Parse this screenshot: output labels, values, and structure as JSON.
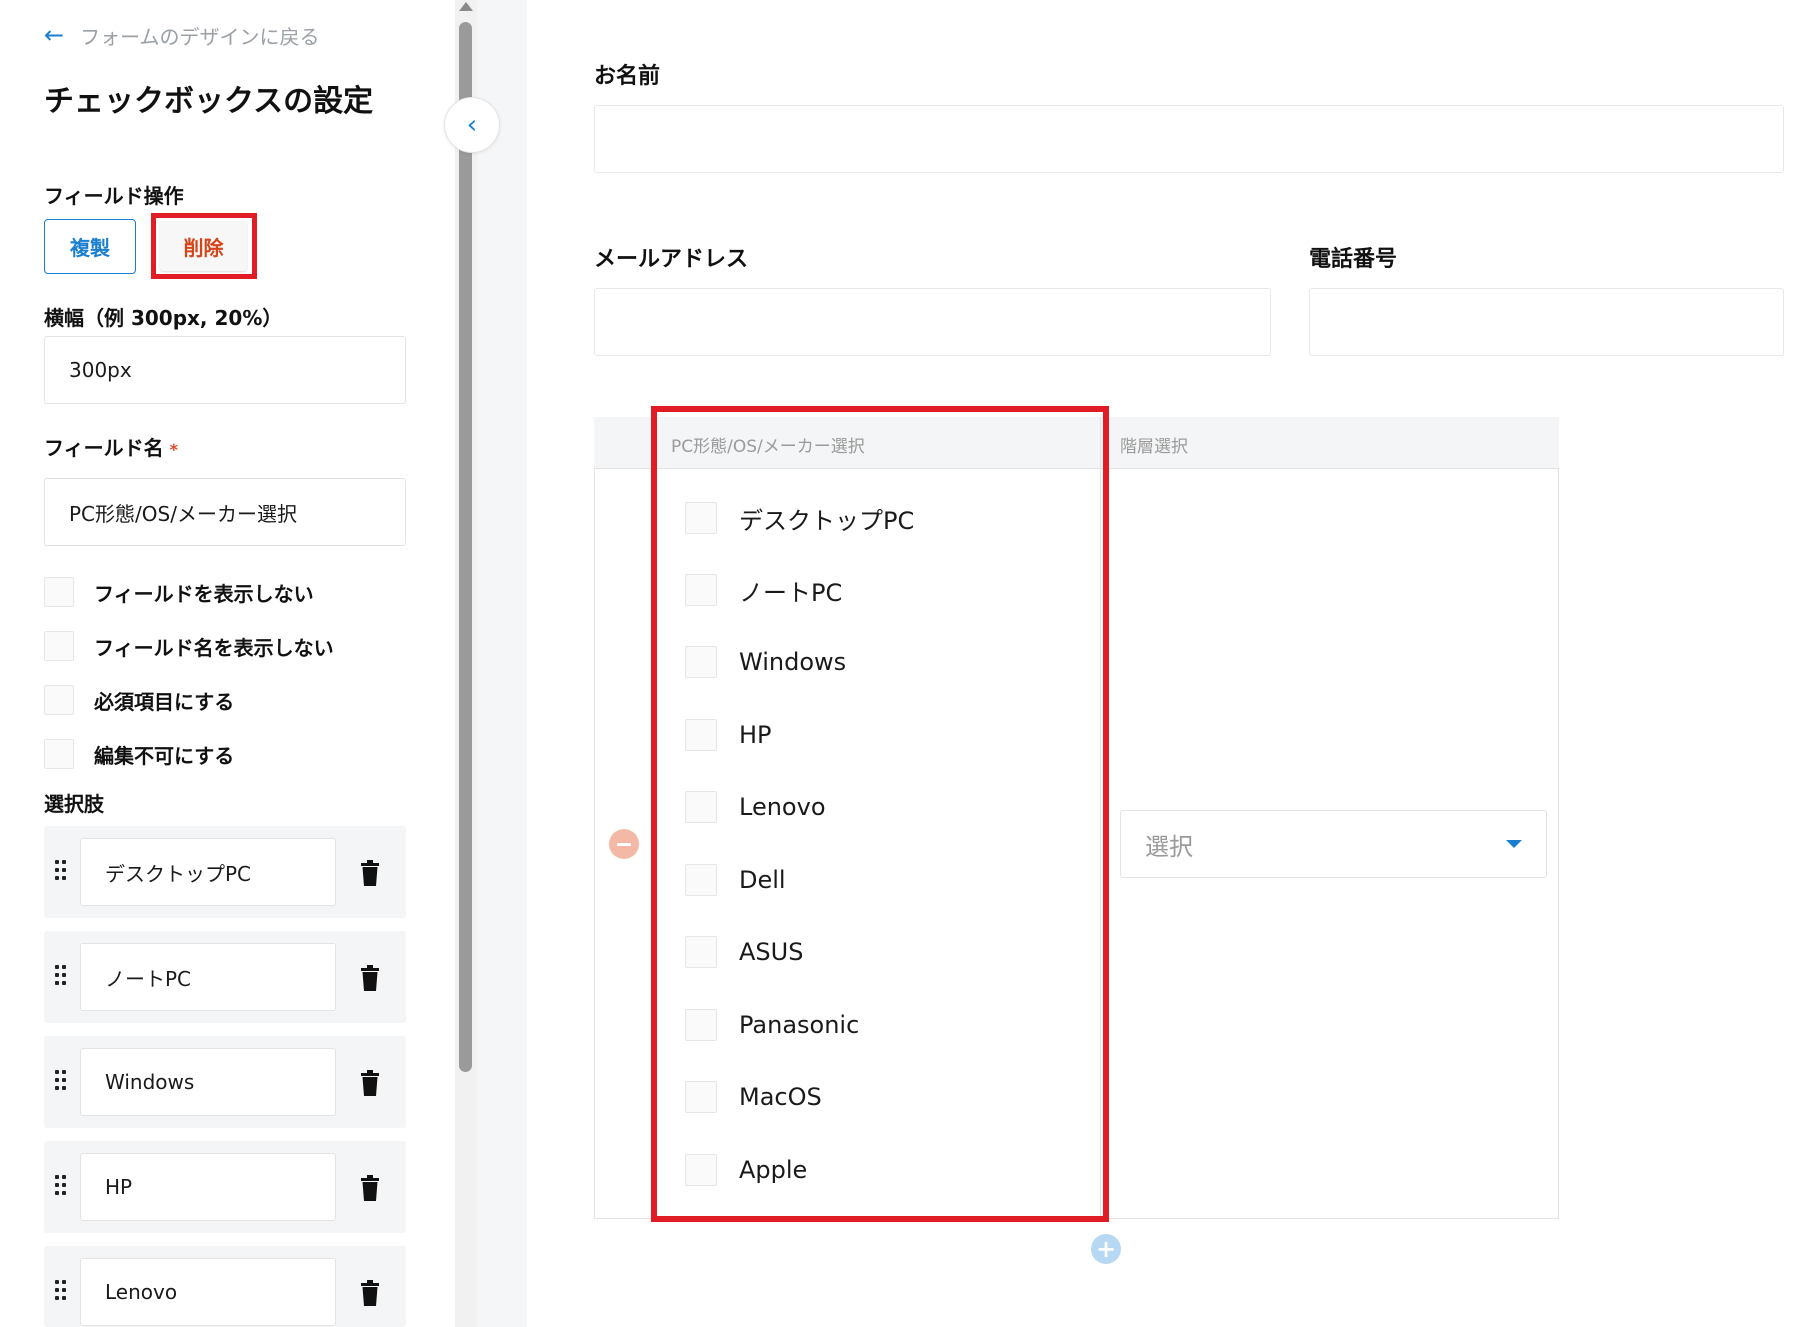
{
  "sidebar": {
    "back_link": "フォームのデザインに戻る",
    "title": "チェックボックスの設定",
    "field_ops_label": "フィールド操作",
    "duplicate_label": "複製",
    "delete_label": "削除",
    "width_label": "横幅（例 300px, 20%）",
    "width_value": "300px",
    "field_name_label": "フィールド名",
    "required_mark": "*",
    "field_name_value": "PC形態/OS/メーカー選択",
    "options": [
      {
        "label": "フィールドを表示しない"
      },
      {
        "label": "フィールド名を表示しない"
      },
      {
        "label": "必須項目にする"
      },
      {
        "label": "編集不可にする"
      }
    ],
    "choices_label": "選択肢",
    "choices": [
      {
        "value": "デスクトップPC"
      },
      {
        "value": "ノートPC"
      },
      {
        "value": "Windows"
      },
      {
        "value": "HP"
      },
      {
        "value": "Lenovo"
      }
    ]
  },
  "form": {
    "name_label": "お名前",
    "email_label": "メールアドレス",
    "phone_label": "電話番号",
    "checkbox_field": {
      "header": "PC形態/OS/メーカー選択",
      "items": [
        {
          "label": "デスクトップPC"
        },
        {
          "label": "ノートPC"
        },
        {
          "label": "Windows"
        },
        {
          "label": "HP"
        },
        {
          "label": "Lenovo"
        },
        {
          "label": "Dell"
        },
        {
          "label": "ASUS"
        },
        {
          "label": "Panasonic"
        },
        {
          "label": "MacOS"
        },
        {
          "label": "Apple"
        }
      ]
    },
    "hier_field": {
      "header": "階層選択",
      "placeholder": "選択"
    }
  },
  "colors": {
    "accent": "#1a7fd0",
    "highlight": "#e01c24",
    "delete_text": "#d6451a"
  }
}
